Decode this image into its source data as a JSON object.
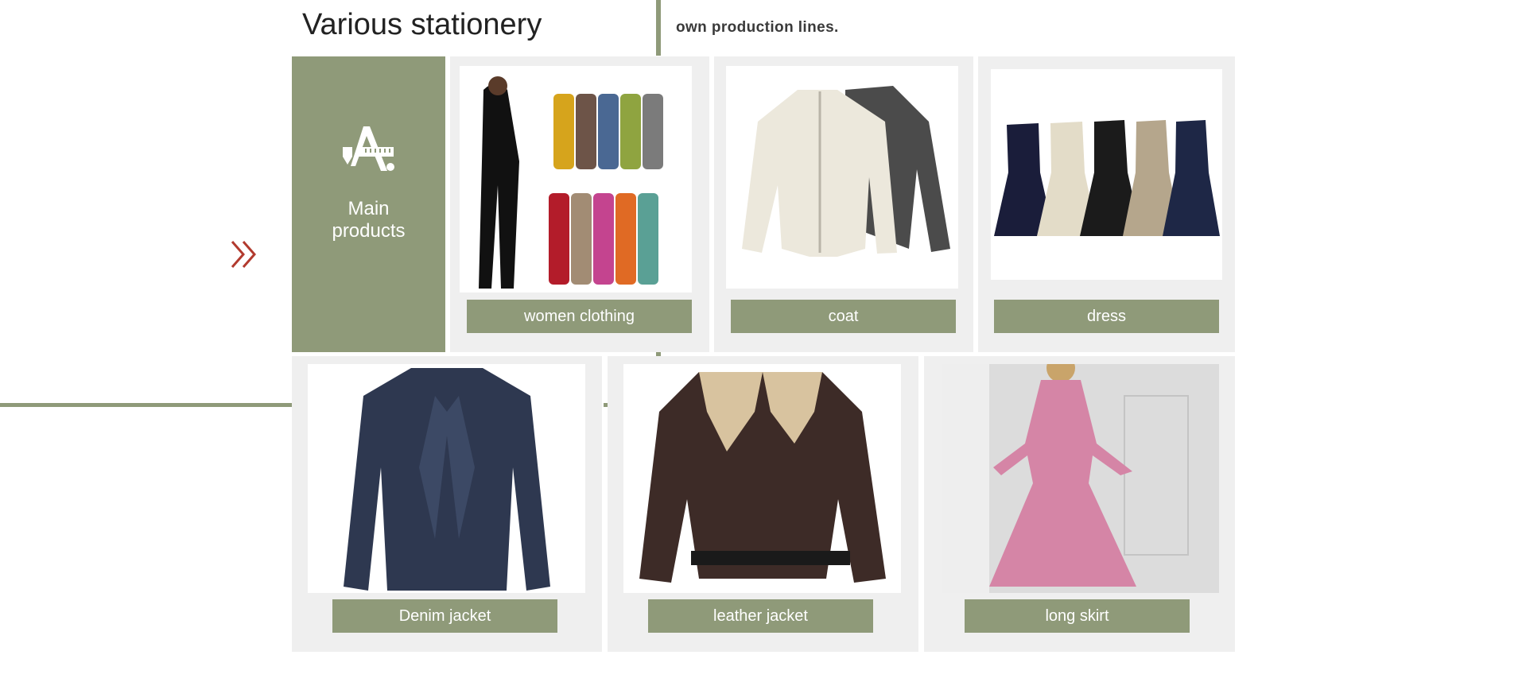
{
  "section": {
    "title": "Various stationery",
    "intro_text": "own production lines."
  },
  "main_products": {
    "label": "Main products",
    "icon": "stationery-tools-icon"
  },
  "nav": {
    "arrow_icon": "double-chevron-right-icon"
  },
  "colors": {
    "accent": "#8f9a79",
    "card_bg": "#efefef",
    "arrow": "#b23a2e",
    "label_text": "#ffffff"
  },
  "products": [
    {
      "label": "women clothing",
      "image": "women-clothing-photo"
    },
    {
      "label": "coat",
      "image": "coat-photo"
    },
    {
      "label": "dress",
      "image": "dress-photo"
    },
    {
      "label": "Denim jacket",
      "image": "denim-jacket-photo"
    },
    {
      "label": "leather jacket",
      "image": "leather-jacket-photo"
    },
    {
      "label": "long skirt",
      "image": "long-skirt-photo"
    }
  ]
}
